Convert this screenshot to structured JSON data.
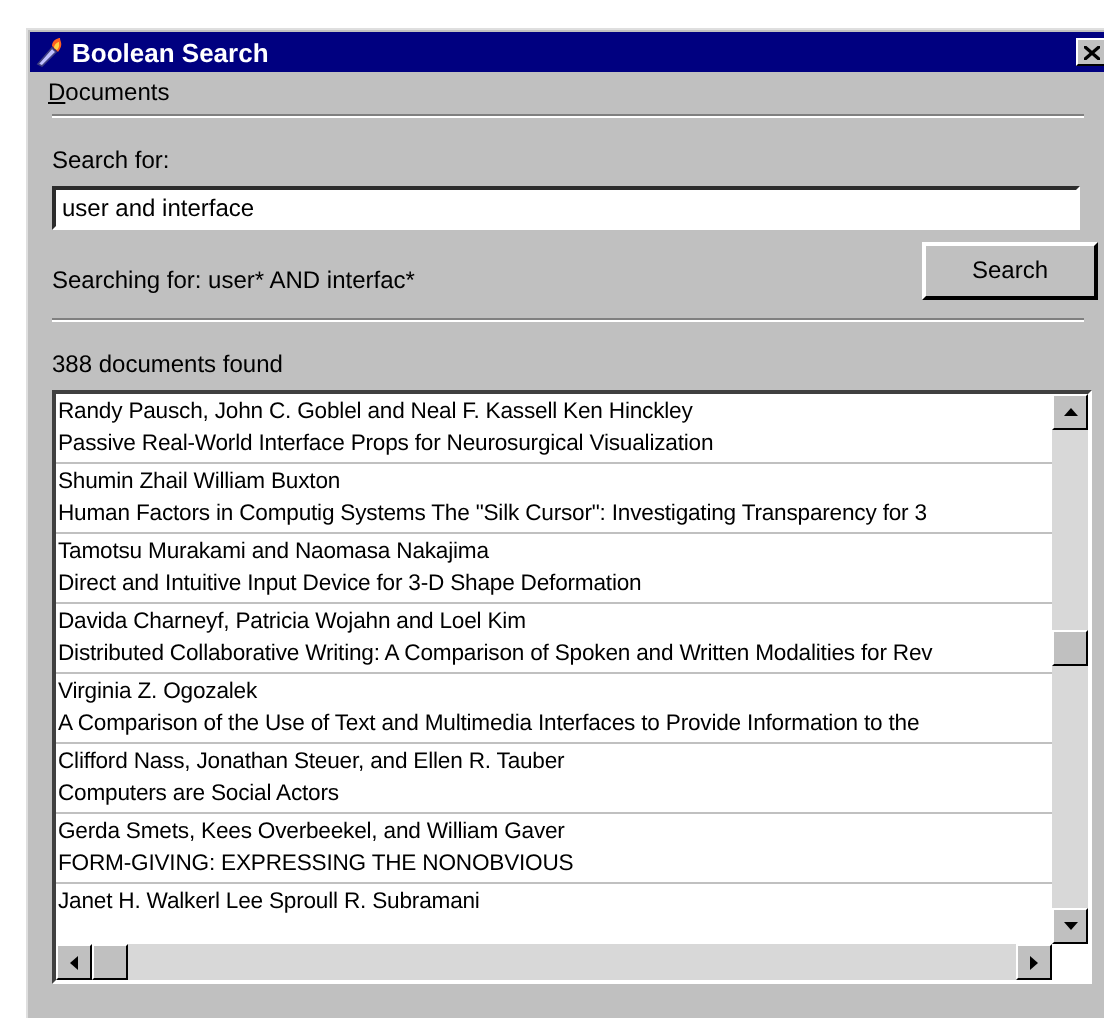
{
  "window": {
    "title": "Boolean Search"
  },
  "menu": [
    {
      "label": "Documents"
    }
  ],
  "search": {
    "label": "Search for:",
    "value": "user and interface",
    "status": "Searching for: user* AND interfac*",
    "button": "Search"
  },
  "results": {
    "count": "388 documents found",
    "rows": [
      {
        "authors": "Randy Pausch, John C. Goblel and Neal F. Kassell Ken Hinckley",
        "title": "Passive Real-World Interface Props for Neurosurgical Visualization"
      },
      {
        "authors": "Shumin Zhail William Buxton",
        "title": "Human Factors in Computig Systems The \"Silk Cursor\": Investigating Transparency for 3"
      },
      {
        "authors": "Tamotsu Murakami and Naomasa Nakajima",
        "title": "Direct and Intuitive Input Device for 3-D Shape Deformation"
      },
      {
        "authors": "Davida Charneyf, Patricia Wojahn and Loel Kim",
        "title": "Distributed Collaborative Writing: A Comparison of Spoken and Written Modalities for Rev"
      },
      {
        "authors": "Virginia Z. Ogozalek",
        "title": "A Comparison of the Use of Text and Multimedia Interfaces to Provide Information to the"
      },
      {
        "authors": "Clifford Nass, Jonathan Steuer, and Ellen R. Tauber",
        "title": "Computers are Social Actors"
      },
      {
        "authors": "Gerda Smets, Kees Overbeekel, and William Gaver",
        "title": "FORM-GIVING: EXPRESSING THE NONOBVIOUS"
      },
      {
        "authors": "Janet H. Walkerl Lee Sproull R. Subramani"
      }
    ]
  }
}
